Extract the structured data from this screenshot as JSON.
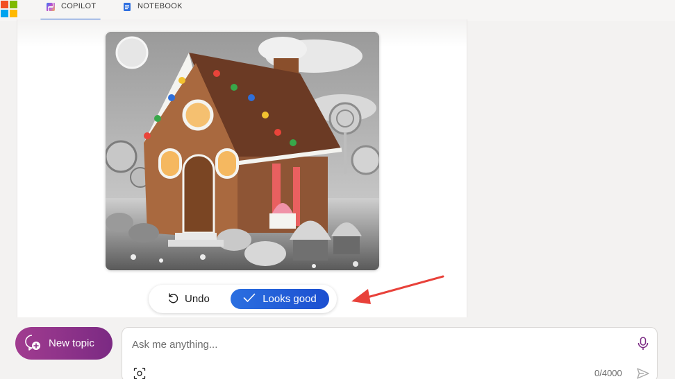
{
  "tabs": [
    {
      "label": "COPILOT",
      "icon": "copilot-icon",
      "active": true
    },
    {
      "label": "NOTEBOOK",
      "icon": "notebook-icon",
      "active": false
    }
  ],
  "logo_colors": [
    "#f25022",
    "#7fba00",
    "#00a4ef",
    "#ffb900"
  ],
  "image": {
    "subject": "gingerbread-house",
    "palette": "grayscale with colored candy"
  },
  "actions": {
    "undo_label": "Undo",
    "looks_good_label": "Looks good"
  },
  "new_topic": {
    "label": "New topic"
  },
  "composer": {
    "placeholder": "Ask me anything...",
    "char_count": "0/4000"
  },
  "colors": {
    "accent": "#1f5fd3",
    "new_topic_gradient": [
      "#a13c90",
      "#7b2a83"
    ],
    "annotation_arrow": "#e8413a"
  }
}
